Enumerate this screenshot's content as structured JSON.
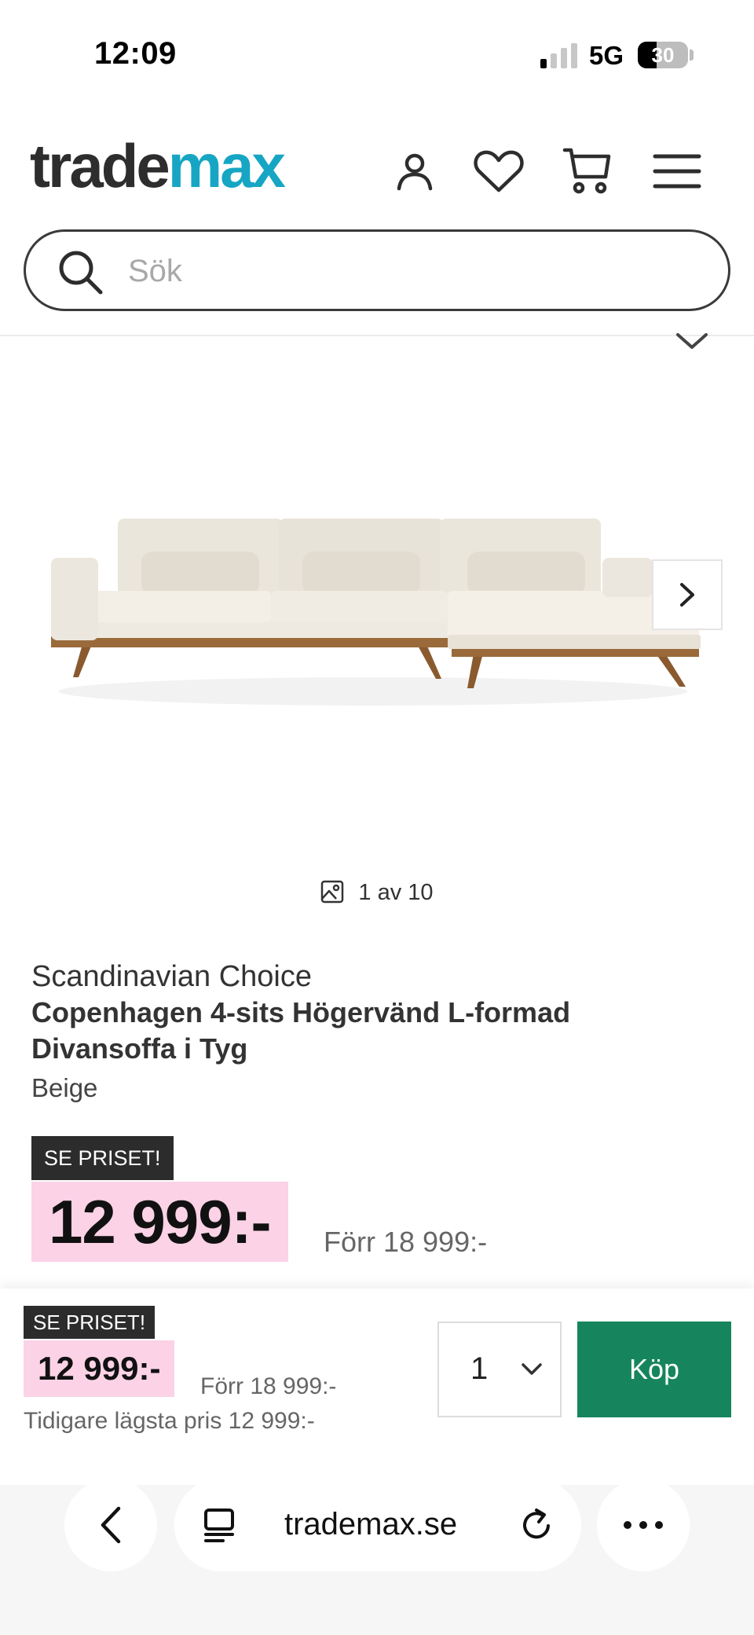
{
  "status_bar": {
    "time": "12:09",
    "network": "5G",
    "battery": "30"
  },
  "header": {
    "logo_part1": "trade",
    "logo_part2": "max",
    "icons": [
      "account-icon",
      "heart-icon",
      "cart-icon",
      "menu-icon"
    ]
  },
  "search": {
    "placeholder": "Sök"
  },
  "gallery": {
    "counter": "1 av 10"
  },
  "product": {
    "brand": "Scandinavian Choice",
    "title": "Copenhagen 4-sits Högervänd L-formad Divansoffa i Tyg",
    "color": "Beige",
    "deal_badge": "SE PRISET!",
    "price": "12 999:-",
    "previous_price": "Förr 18 999:-"
  },
  "buy_bar": {
    "deal_badge": "SE PRISET!",
    "price": "12 999:-",
    "previous_price": "Förr 18 999:-",
    "lowest_price": "Tidigare lägsta pris 12 999:-",
    "quantity": "1",
    "buy_label": "Köp"
  },
  "browser": {
    "url": "trademax.se"
  },
  "colors": {
    "brand_teal": "#16a6c4",
    "price_highlight": "#fbd2e6",
    "buy_green": "#16855e",
    "badge_dark": "#2c2c2c"
  }
}
